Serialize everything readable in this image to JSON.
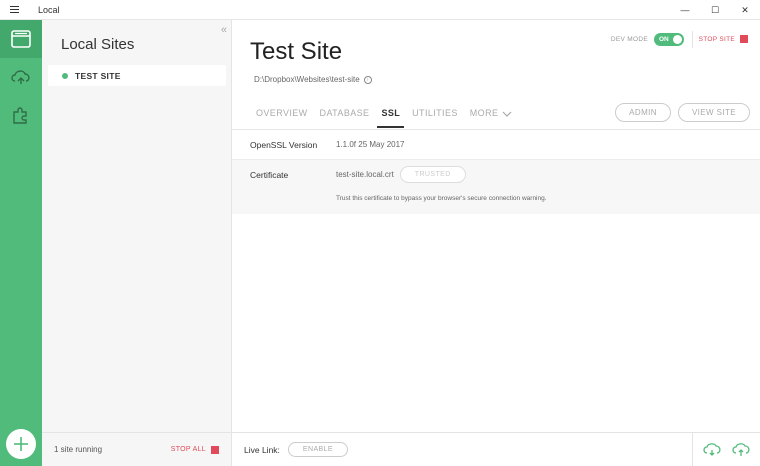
{
  "window": {
    "title": "Local",
    "minimize_glyph": "—",
    "maximize_glyph": "☐",
    "close_glyph": "✕"
  },
  "theme": {
    "accent": "#51bb7b",
    "danger": "#e04a5a"
  },
  "rail": {
    "icons": [
      "sites-icon",
      "cloud-icon",
      "puzzle-icon",
      "add-icon"
    ]
  },
  "sites_panel": {
    "title": "Local Sites",
    "collapse_glyph": "«",
    "sites": [
      {
        "name": "TEST SITE",
        "status": "running"
      }
    ],
    "running_text": "1 site running",
    "stop_all_label": "STOP ALL"
  },
  "header": {
    "site_title": "Test Site",
    "site_path": "D:\\Dropbox\\Websites\\test-site",
    "dev_mode_label": "DEV MODE",
    "dev_mode_state": "ON",
    "stop_site_label": "STOP SITE"
  },
  "tabs": [
    {
      "label": "OVERVIEW",
      "active": false
    },
    {
      "label": "DATABASE",
      "active": false
    },
    {
      "label": "SSL",
      "active": true
    },
    {
      "label": "UTILITIES",
      "active": false
    },
    {
      "label": "MORE",
      "active": false
    }
  ],
  "tab_buttons": {
    "admin_label": "ADMIN",
    "view_site_label": "VIEW SITE"
  },
  "ssl": {
    "openssl_label": "OpenSSL Version",
    "openssl_value": "1.1.0f  25 May 2017",
    "certificate_label": "Certificate",
    "certificate_file": "test-site.local.crt",
    "trusted_label": "TRUSTED",
    "help_text": "Trust this certificate to bypass your browser's secure connection warning."
  },
  "footer": {
    "live_link_label": "Live Link:",
    "enable_label": "ENABLE"
  }
}
